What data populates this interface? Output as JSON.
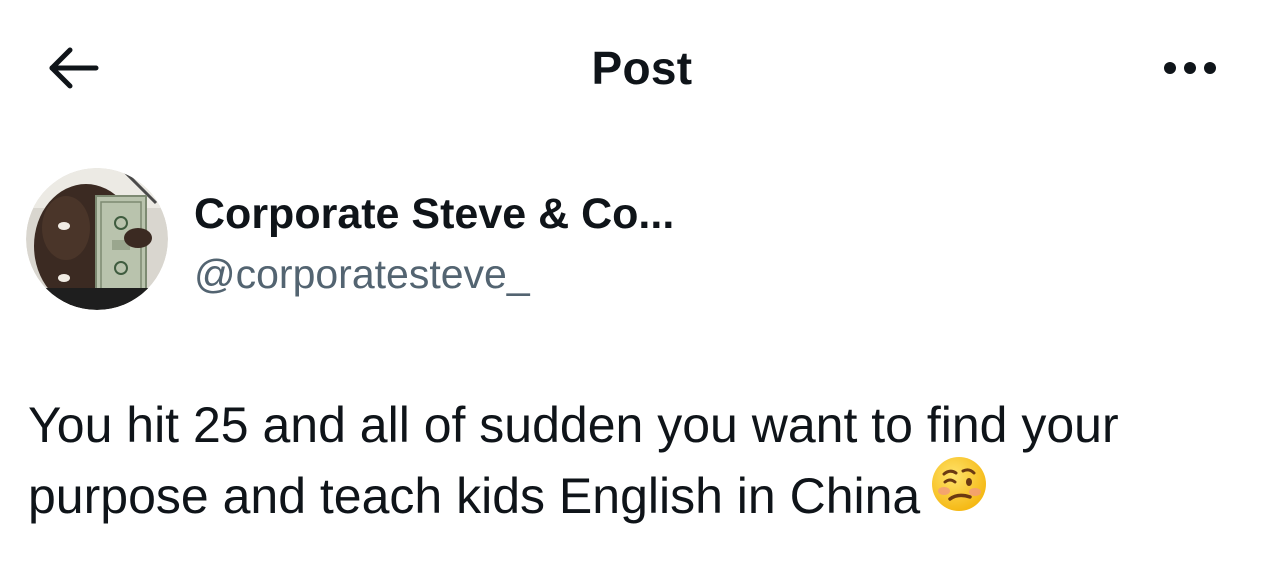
{
  "header": {
    "title": "Post",
    "back_icon": "arrow-left-icon",
    "more_icon": "more-horizontal-icon"
  },
  "author": {
    "display_name": "Corporate Steve & Co...",
    "handle": "@corporatesteve_",
    "avatar_icon": "profile-avatar"
  },
  "post": {
    "text": "You hit 25 and all of sudden you want to find your purpose and teach kids English in China",
    "emoji": "woozy-face-emoji"
  },
  "colors": {
    "primary_text": "#0f1419",
    "secondary_text": "#536471",
    "background": "#ffffff"
  }
}
